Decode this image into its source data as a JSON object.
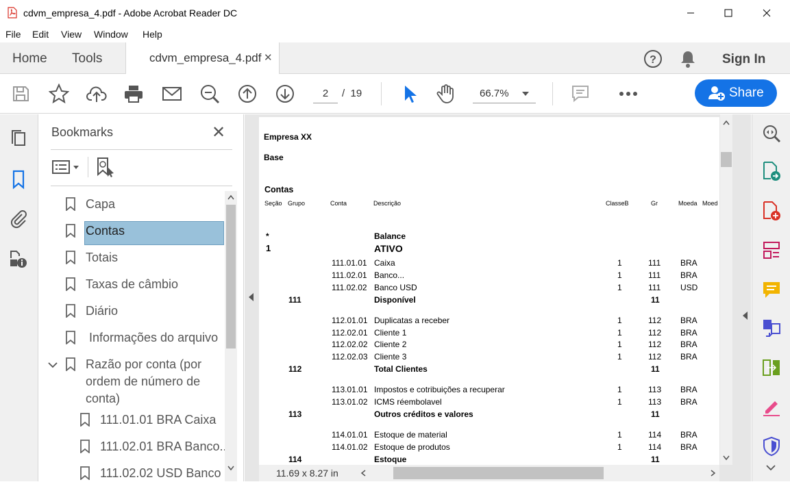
{
  "window": {
    "title": "cdvm_empresa_4.pdf - Adobe Acrobat Reader DC"
  },
  "menu": [
    "File",
    "Edit",
    "View",
    "Window",
    "Help"
  ],
  "tabs": {
    "home": "Home",
    "tools": "Tools",
    "document": "cdvm_empresa_4.pdf",
    "sign_in": "Sign In"
  },
  "toolbar": {
    "page_current": "2",
    "page_separator": "/",
    "page_total": "19",
    "zoom": "66.7%",
    "share_label": "Share"
  },
  "bookmarks": {
    "title": "Bookmarks",
    "items": [
      {
        "label": "Capa"
      },
      {
        "label": "Contas",
        "selected": true
      },
      {
        "label": "Totais"
      },
      {
        "label": "Taxas de câmbio"
      },
      {
        "label": "Diário"
      },
      {
        "label": "Informações do arquivo"
      },
      {
        "label_lines": [
          "Razão por conta (por",
          "ordem de número de",
          "conta)"
        ],
        "expanded": true
      },
      {
        "label": "111.01.01 BRA Caixa"
      },
      {
        "label": "111.02.01 BRA Banco..."
      },
      {
        "label": "111.02.02 USD Banco"
      }
    ]
  },
  "document": {
    "company": "Empresa XX",
    "base": "Base",
    "section_title": "Contas",
    "headers": [
      "Seção",
      "Grupo",
      "Conta",
      "Descrição",
      "ClasseB",
      "Gr",
      "Moeda",
      "Moed"
    ],
    "rows": [
      {
        "secao": "*",
        "descricao": "Balance",
        "bold": true
      },
      {
        "secao": "1",
        "descricao": "ATIVO",
        "bold": true,
        "large": true
      },
      {
        "conta": "111.01.01",
        "descricao": "Caixa",
        "classe": "1",
        "gr": "111",
        "moeda": "BRA"
      },
      {
        "conta": "111.02.01",
        "descricao": "Banco...",
        "classe": "1",
        "gr": "111",
        "moeda": "BRA"
      },
      {
        "conta": "111.02.02",
        "descricao": "Banco USD",
        "classe": "1",
        "gr": "111",
        "moeda": "USD"
      },
      {
        "grupo": "111",
        "descricao": "Disponível",
        "gr": "11",
        "bold": true
      },
      {
        "conta": "112.01.01",
        "descricao": "Duplicatas a receber",
        "classe": "1",
        "gr": "112",
        "moeda": "BRA"
      },
      {
        "conta": "112.02.01",
        "descricao": "Cliente 1",
        "classe": "1",
        "gr": "112",
        "moeda": "BRA"
      },
      {
        "conta": "112.02.02",
        "descricao": "Cliente 2",
        "classe": "1",
        "gr": "112",
        "moeda": "BRA"
      },
      {
        "conta": "112.02.03",
        "descricao": "Cliente 3",
        "classe": "1",
        "gr": "112",
        "moeda": "BRA"
      },
      {
        "grupo": "112",
        "descricao": "Total Clientes",
        "gr": "11",
        "bold": true
      },
      {
        "conta": "113.01.01",
        "descricao": "Impostos e cotribuições a recuperar",
        "classe": "1",
        "gr": "113",
        "moeda": "BRA"
      },
      {
        "conta": "113.01.02",
        "descricao": "ICMS réembolavel",
        "classe": "1",
        "gr": "113",
        "moeda": "BRA"
      },
      {
        "grupo": "113",
        "descricao": "Outros créditos e valores",
        "gr": "11",
        "bold": true
      },
      {
        "conta": "114.01.01",
        "descricao": "Estoque de material",
        "classe": "1",
        "gr": "114",
        "moeda": "BRA"
      },
      {
        "conta": "114.01.02",
        "descricao": "Estoque de produtos",
        "classe": "1",
        "gr": "114",
        "moeda": "BRA"
      },
      {
        "grupo": "114",
        "descricao": "Estoque",
        "gr": "11",
        "bold": true
      }
    ],
    "page_size": "11.69 x 8.27 in"
  },
  "colors": {
    "accent": "#1473e6",
    "selected_bookmark": "#99c1da"
  }
}
